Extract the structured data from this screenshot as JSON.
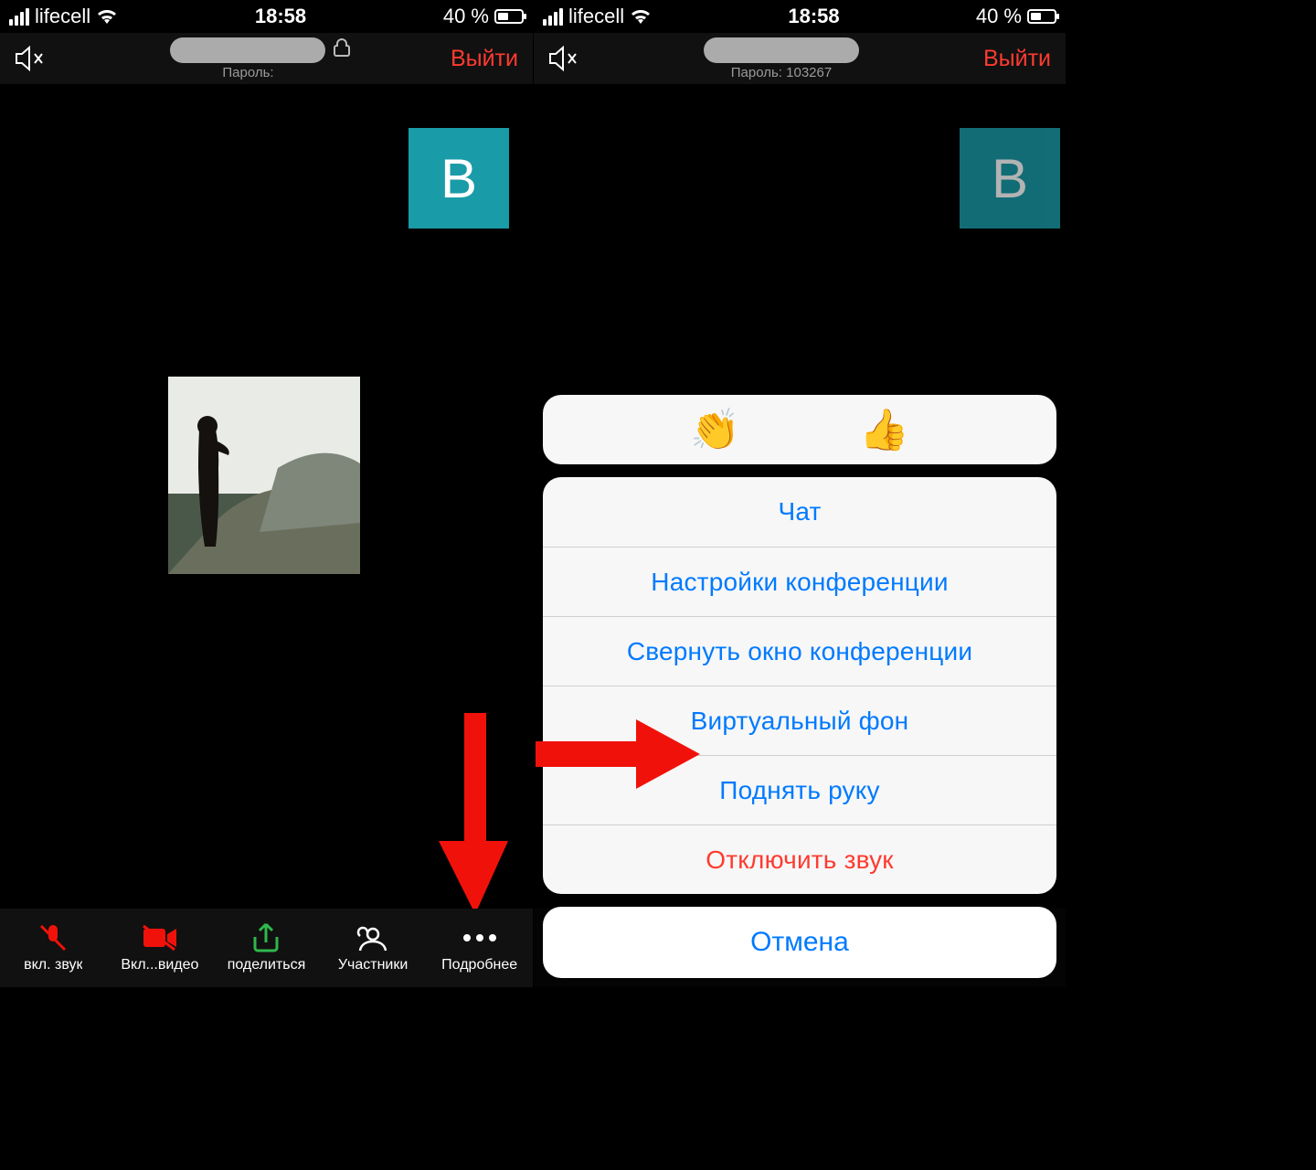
{
  "status": {
    "carrier": "lifecell",
    "time": "18:58",
    "battery_text": "40 %"
  },
  "header": {
    "password_label_left": "Пароль:",
    "password_label_right": "Пароль: 103267",
    "leave": "Выйти"
  },
  "tile_letter": "В",
  "toolbar": {
    "audio": "вкл. звук",
    "video": "Вкл...видео",
    "share": "поделиться",
    "participants": "Участники",
    "more": "Подробнее"
  },
  "emoji": {
    "clap": "👏",
    "thumbs": "👍"
  },
  "sheet": {
    "chat": "Чат",
    "settings": "Настройки конференции",
    "minimize": "Свернуть окно конференции",
    "vb": "Виртуальный фон",
    "raise": "Поднять руку",
    "mute": "Отключить звук",
    "cancel": "Отмена"
  }
}
